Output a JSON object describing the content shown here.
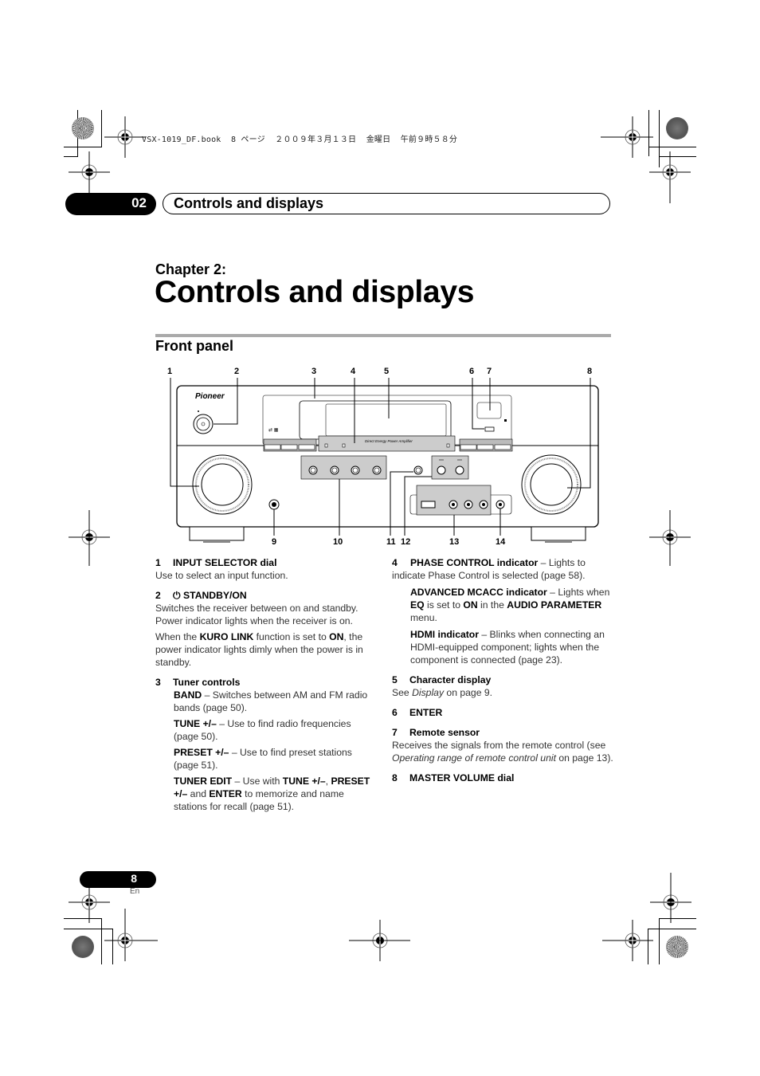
{
  "print_header": "VSX-1019_DF.book  8 ページ  ２００９年３月１３日  金曜日  午前９時５８分",
  "chapter_bar": {
    "number": "02",
    "title": "Controls and displays"
  },
  "chapter_label": "Chapter 2:",
  "chapter_title": "Controls and displays",
  "section_title": "Front panel",
  "diagram": {
    "brand_logo": "Pioneer",
    "panel_text": "Direct Energy Power Amplifier",
    "top_callouts": [
      "1",
      "2",
      "3",
      "4",
      "5",
      "6",
      "7",
      "8"
    ],
    "bottom_callouts": [
      "9",
      "10",
      "11",
      "12",
      "13",
      "14"
    ]
  },
  "items_left": [
    {
      "num": "1",
      "title": "INPUT SELECTOR dial",
      "body": "Use to select an input function."
    },
    {
      "num": "2",
      "icon": "power-icon",
      "icon_glyph": "⏻",
      "title": "STANDBY/ON",
      "body": "Switches the receiver between on and standby. Power indicator lights when the receiver is on.",
      "body2_pre": "When the ",
      "body2_b1": "KURO LINK",
      "body2_mid": " function is set to ",
      "body2_b2": "ON",
      "body2_post": ", the power indicator lights dimly when the power is in standby."
    },
    {
      "num": "3",
      "title": "Tuner controls",
      "band_b": "BAND",
      "band_t": " – Switches between AM and FM radio bands (page 50).",
      "tune_b": "TUNE +/–",
      "tune_t": " – Use to find radio frequencies (page 50).",
      "preset_b": "PRESET +/–",
      "preset_t": " – Use to find preset stations (page 51).",
      "edit_b": "TUNER EDIT",
      "edit_t1": " – Use with ",
      "edit_b2": "TUNE +/–",
      "edit_t2": ", ",
      "edit_b3": "PRESET +/–",
      "edit_t3": " and ",
      "edit_b4": "ENTER",
      "edit_t4": " to memorize and name stations for recall (page 51)."
    }
  ],
  "items_right": [
    {
      "num": "4",
      "phase_b": "PHASE CONTROL indicator",
      "phase_t": " – Lights to indicate Phase Control is selected (page 58).",
      "mcacc_b": "ADVANCED MCACC indicator",
      "mcacc_t1": " – Lights when ",
      "mcacc_b2": "EQ",
      "mcacc_t2": " is set to ",
      "mcacc_b3": "ON",
      "mcacc_t3": " in the ",
      "mcacc_b4": "AUDIO PARAMETER",
      "mcacc_t4": " menu.",
      "hdmi_b": "HDMI indicator",
      "hdmi_t": " – Blinks when connecting an HDMI-equipped component; lights when the component is connected (page 23)."
    },
    {
      "num": "5",
      "title": "Character display",
      "body_pre": "See ",
      "body_i": "Display",
      "body_post": " on page 9."
    },
    {
      "num": "6",
      "title": "ENTER"
    },
    {
      "num": "7",
      "title": "Remote sensor",
      "body_pre": "Receives the signals from the remote control (see ",
      "body_i": "Operating range of remote control unit",
      "body_post": " on page 13)."
    },
    {
      "num": "8",
      "title": "MASTER VOLUME dial"
    }
  ],
  "footer": {
    "page_number": "8",
    "language": "En"
  }
}
